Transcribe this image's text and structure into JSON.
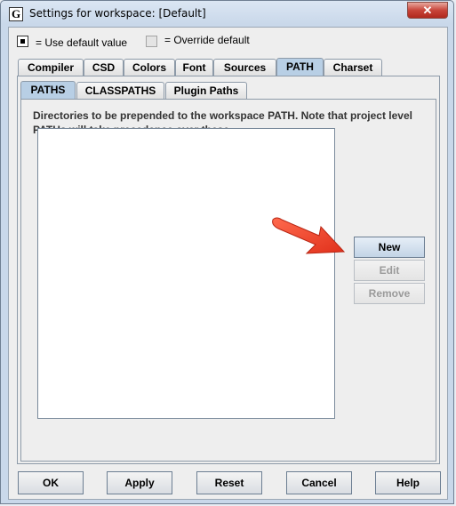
{
  "window": {
    "title": "Settings for workspace: [Default]",
    "app_icon_letter": "G",
    "close_glyph": "✕"
  },
  "legend": {
    "default_label": "= Use default value",
    "override_label": "= Override default"
  },
  "main_tabs": [
    {
      "label": "Compiler",
      "selected": false
    },
    {
      "label": "CSD",
      "selected": false
    },
    {
      "label": "Colors",
      "selected": false
    },
    {
      "label": "Font",
      "selected": false
    },
    {
      "label": "Sources",
      "selected": false
    },
    {
      "label": "PATH",
      "selected": true
    },
    {
      "label": "Charset",
      "selected": false
    }
  ],
  "sub_tabs": [
    {
      "label": "PATHS",
      "selected": true
    },
    {
      "label": "CLASSPATHS",
      "selected": false
    },
    {
      "label": "Plugin Paths",
      "selected": false
    }
  ],
  "paths_panel": {
    "description": "Directories to be prepended to the workspace PATH. Note that project level PATHs will take precedence over these.",
    "items": [],
    "buttons": {
      "new": "New",
      "edit": "Edit",
      "remove": "Remove"
    }
  },
  "dialog_buttons": {
    "ok": "OK",
    "apply": "Apply",
    "reset": "Reset",
    "cancel": "Cancel",
    "help": "Help"
  },
  "colors": {
    "annotation_arrow": "#f0402a",
    "selected_tab": "#b8cfe5"
  }
}
